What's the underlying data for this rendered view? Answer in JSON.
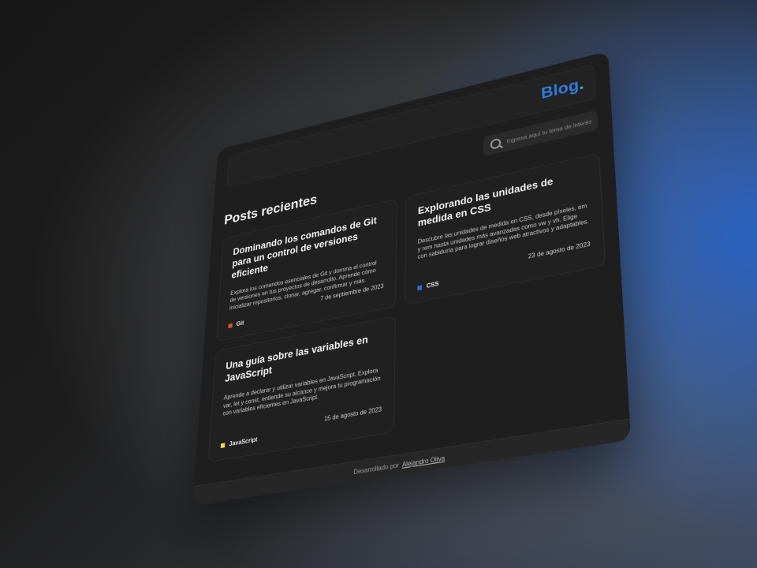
{
  "header": {
    "brand": "Blog",
    "brand_dot": ".",
    "brand_color": "#2f7de0",
    "brand_dot_color": "#1fc7c2"
  },
  "search": {
    "placeholder": "Ingresa aquí tu tema de interés..."
  },
  "main": {
    "section_title": "Posts recientes",
    "posts": [
      {
        "title": "Dominando los comandos de Git para un control de versiones eficiente",
        "description": "Explora los comandos esenciales de Git y domina el control de versiones en tus proyectos de desarrollo. Aprende cómo inicializar repositorios, clonar, agregar, confirmar y más.",
        "tag": "Git",
        "tag_color": "#e0522f",
        "date": "7 de septiembre de 2023"
      },
      {
        "title": "Explorando las unidades de medida en CSS",
        "description": "Descubre las unidades de medida en CSS, desde píxeles, em y rem hasta unidades más avanzadas como vw y vh. Elige con sabiduría para lograr diseños web atractivos y adaptables.",
        "tag": "CSS",
        "tag_color": "#2f6fe0",
        "date": "23 de agosto de 2023"
      },
      {
        "title": "Una guía sobre las variables en JavaScript",
        "description": "Aprende a declarar y utilizar variables en JavaScript. Explora var, let y const, entiende su alcance y mejora tu programación con variables eficientes en JavaScript.",
        "tag": "JavaScript",
        "tag_color": "#f0d94a",
        "date": "15 de agosto de 2023"
      }
    ]
  },
  "footer": {
    "text": "Desarrollado por",
    "author": "Alejandro Oliva"
  }
}
